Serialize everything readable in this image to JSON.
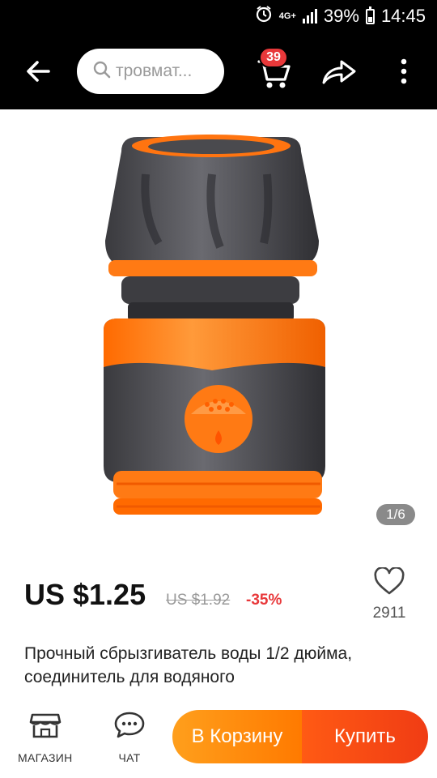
{
  "status_bar": {
    "network": "4G+",
    "battery": "39%",
    "time": "14:45"
  },
  "app_bar": {
    "search_text": "тровмат...",
    "cart_badge": "39"
  },
  "gallery": {
    "counter": "1/6"
  },
  "product": {
    "price": "US $1.25",
    "old_price": "US $1.92",
    "discount": "-35%",
    "wishlist_count": "2911",
    "title": "Прочный сбрызгиватель воды 1/2 дюйма, соединитель для водяного"
  },
  "bottom_bar": {
    "store_label": "МАГАЗИН",
    "chat_label": "ЧАТ",
    "add_to_cart": "В Корзину",
    "buy": "Купить"
  },
  "colors": {
    "accent_orange": "#ff7a00",
    "buy_red": "#f03c14",
    "price_red": "#e8383a"
  }
}
